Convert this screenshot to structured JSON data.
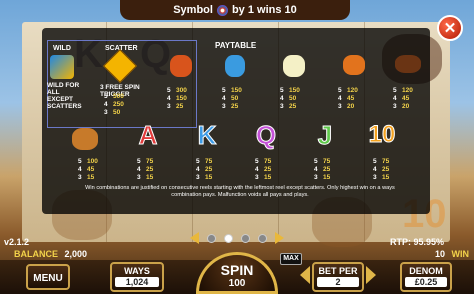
{
  "header": {
    "symbol_label": "Symbol",
    "wins_text": "by 1 wins 10"
  },
  "paytable": {
    "title": "PAYTABLE",
    "wild_label": "WILD",
    "wild_note": "WILD FOR ALL EXCEPT SCATTERS",
    "scatter_label": "SCATTER",
    "scatter_note": "3 FREE SPIN TRIGGER",
    "pay_groups": [
      {
        "rows": [
          [
            "5",
            "500"
          ],
          [
            "4",
            "250"
          ],
          [
            "3",
            "50"
          ]
        ]
      },
      {
        "rows": [
          [
            "5",
            "300"
          ],
          [
            "4",
            "150"
          ],
          [
            "3",
            "25"
          ]
        ]
      },
      {
        "rows": [
          [
            "5",
            "150"
          ],
          [
            "4",
            "50"
          ],
          [
            "3",
            "25"
          ]
        ]
      },
      {
        "rows": [
          [
            "5",
            "150"
          ],
          [
            "4",
            "50"
          ],
          [
            "3",
            "25"
          ]
        ]
      },
      {
        "rows": [
          [
            "5",
            "120"
          ],
          [
            "4",
            "45"
          ],
          [
            "3",
            "20"
          ]
        ]
      },
      {
        "rows": [
          [
            "5",
            "120"
          ],
          [
            "4",
            "45"
          ],
          [
            "3",
            "20"
          ]
        ]
      },
      {
        "rows": [
          [
            "5",
            "100"
          ],
          [
            "4",
            "45"
          ],
          [
            "3",
            "15"
          ]
        ]
      },
      {
        "rows": [
          [
            "5",
            "75"
          ],
          [
            "4",
            "25"
          ],
          [
            "3",
            "15"
          ]
        ]
      },
      {
        "rows": [
          [
            "5",
            "75"
          ],
          [
            "4",
            "25"
          ],
          [
            "3",
            "15"
          ]
        ]
      },
      {
        "rows": [
          [
            "5",
            "75"
          ],
          [
            "4",
            "25"
          ],
          [
            "3",
            "15"
          ]
        ]
      },
      {
        "rows": [
          [
            "5",
            "75"
          ],
          [
            "4",
            "25"
          ],
          [
            "3",
            "15"
          ]
        ]
      },
      {
        "rows": [
          [
            "5",
            "75"
          ],
          [
            "4",
            "25"
          ],
          [
            "3",
            "15"
          ]
        ]
      }
    ],
    "letters": [
      "A",
      "K",
      "Q",
      "J",
      "10"
    ],
    "rules_text": "Win combinations are justified on consecutive reels starting with the leftmost reel except scatters. Only highest win on a ways combination pays. Malfunction voids all pays and plays."
  },
  "status": {
    "version": "v2.1.2",
    "rtp": "RTP: 95.95%",
    "balance_label": "BALANCE",
    "balance_value": "2,000",
    "win_value": "10",
    "win_label": "WIN"
  },
  "controls": {
    "menu_label": "MENU",
    "ways_label": "WAYS",
    "ways_value": "1,024",
    "spin_label": "SPIN",
    "spin_value": "100",
    "max_label": "MAX",
    "betper_label": "BET PER",
    "betper_value": "2",
    "denom_label": "DENOM",
    "denom_value": "£0.25"
  },
  "pager": {
    "pages": 4,
    "active_index": 1
  },
  "colors": {
    "accent_gold": "#e0b648",
    "close_red": "#d6300f",
    "pay_yellow": "#f3d34a"
  }
}
